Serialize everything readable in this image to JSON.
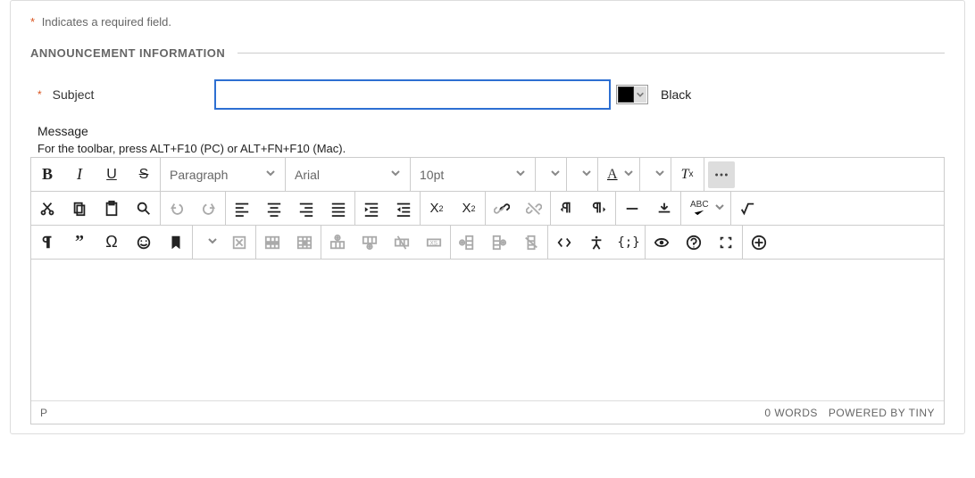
{
  "required_note_prefix": "*",
  "required_note_text": "Indicates a required field.",
  "section_title": "ANNOUNCEMENT INFORMATION",
  "subject": {
    "required_mark": "*",
    "label": "Subject",
    "value": "",
    "placeholder": ""
  },
  "colorpicker": {
    "swatch_hex": "#000000",
    "selected_name": "Black"
  },
  "message_label": "Message",
  "toolbar_hint": "For the toolbar, press ALT+F10 (PC) or ALT+FN+F10 (Mac).",
  "dropdowns": {
    "block_format": "Paragraph",
    "font_family": "Arial",
    "font_size": "10pt"
  },
  "spellcheck_label": "ABC",
  "status": {
    "path": "P",
    "wordcount": "0 WORDS",
    "powered": "POWERED BY TINY"
  }
}
